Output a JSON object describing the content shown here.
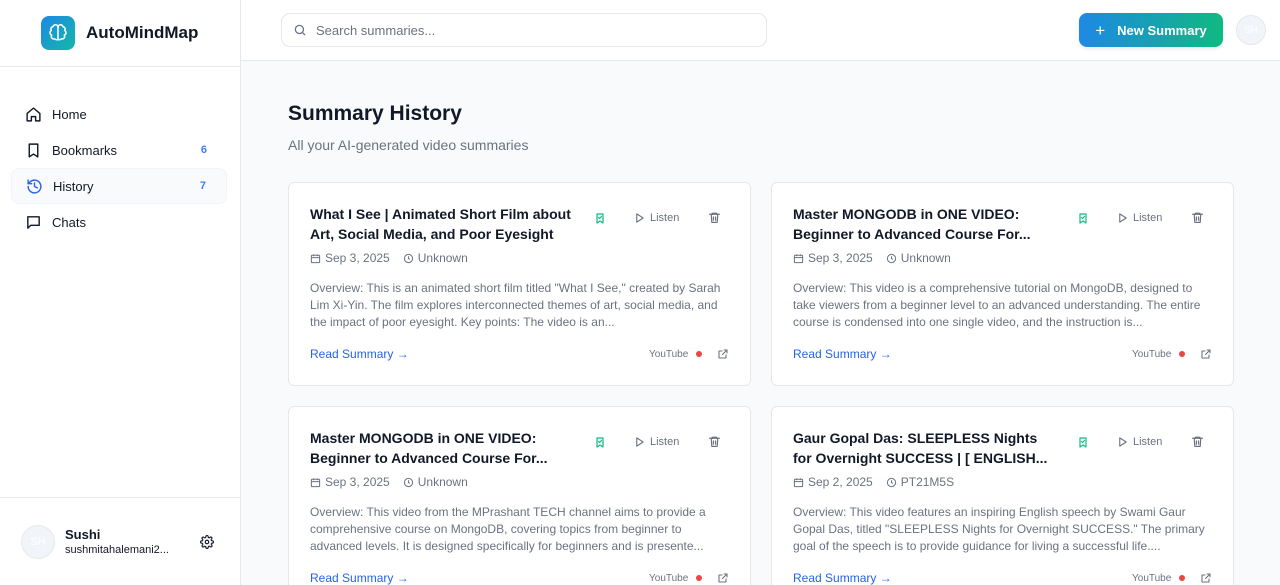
{
  "app": {
    "name": "AutoMindMap"
  },
  "search": {
    "placeholder": "Search summaries..."
  },
  "header": {
    "new_summary_label": "New Summary",
    "avatar_initials": "SH"
  },
  "sidebar": {
    "items": [
      {
        "label": "Home",
        "count": ""
      },
      {
        "label": "Bookmarks",
        "count": "6"
      },
      {
        "label": "History",
        "count": "7"
      },
      {
        "label": "Chats",
        "count": ""
      }
    ],
    "active": "History"
  },
  "user": {
    "initials": "SH",
    "name": "Sushi",
    "email": "sushmitahalemani2..."
  },
  "page": {
    "title": "Summary History",
    "subtitle": "All your AI-generated video summaries"
  },
  "cards": [
    {
      "title": "What I See | Animated Short Film about Art, Social Media, and Poor Eyesight",
      "date": "Sep 3, 2025",
      "duration": "Unknown",
      "overview": "Overview: This is an animated short film titled \"What I See,\" created by Sarah Lim Xi-Yin. The film explores interconnected themes of art, social media, and the impact of poor eyesight. Key points: The video is an...",
      "read_label": "Read Summary →",
      "listen_label": "Listen",
      "source": "YouTube"
    },
    {
      "title": "Master MONGODB in ONE VIDEO: Beginner to Advanced Course For...",
      "date": "Sep 3, 2025",
      "duration": "Unknown",
      "overview": "Overview: This video is a comprehensive tutorial on MongoDB, designed to take viewers from a beginner level to an advanced understanding. The entire course is condensed into one single video, and the instruction is...",
      "read_label": "Read Summary →",
      "listen_label": "Listen",
      "source": "YouTube"
    },
    {
      "title": "Master MONGODB in ONE VIDEO: Beginner to Advanced Course For...",
      "date": "Sep 3, 2025",
      "duration": "Unknown",
      "overview": "Overview: This video from the MPrashant TECH channel aims to provide a comprehensive course on MongoDB, covering topics from beginner to advanced levels. It is designed specifically for beginners and is presente...",
      "read_label": "Read Summary →",
      "listen_label": "Listen",
      "source": "YouTube"
    },
    {
      "title": "Gaur Gopal Das: SLEEPLESS Nights for Overnight SUCCESS | [ ENGLISH...",
      "date": "Sep 2, 2025",
      "duration": "PT21M5S",
      "overview": "Overview: This video features an inspiring English speech by Swami Gaur Gopal Das, titled \"SLEEPLESS Nights for Overnight SUCCESS.\" The primary goal of the speech is to provide guidance for living a successful life....",
      "read_label": "Read Summary →",
      "listen_label": "Listen",
      "source": "YouTube"
    }
  ],
  "colors": {
    "accent": "#2563eb",
    "brand_start": "#1e88e5",
    "brand_end": "#10b981",
    "bookmark": "#10b981",
    "source_dot": "#ef4444"
  }
}
